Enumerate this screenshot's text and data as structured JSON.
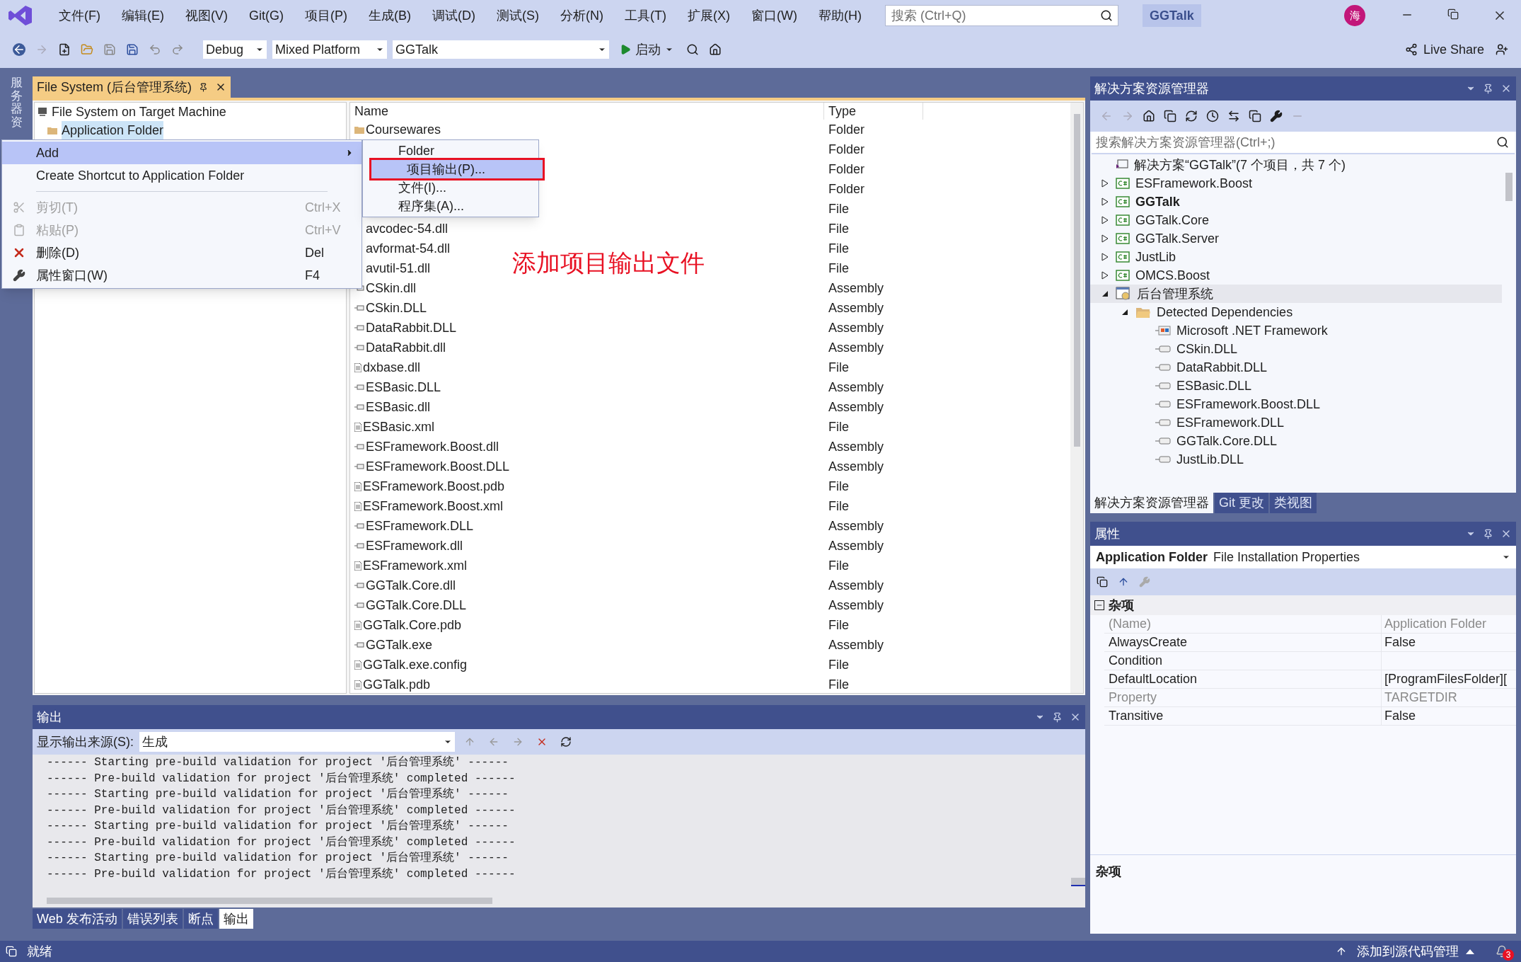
{
  "menu_bar": {
    "items": [
      "文件(F)",
      "编辑(E)",
      "视图(V)",
      "Git(G)",
      "项目(P)",
      "生成(B)",
      "调试(D)",
      "测试(S)",
      "分析(N)",
      "工具(T)",
      "扩展(X)",
      "窗口(W)",
      "帮助(H)"
    ],
    "search": {
      "placeholder": "搜索 (Ctrl+Q)"
    },
    "solution_name": "GGTalk",
    "avatar": "海"
  },
  "toolbar": {
    "configuration": "Debug",
    "platform": "Mixed Platform",
    "startup_project": "GGTalk",
    "start": "启动",
    "live_share": "Live Share"
  },
  "side_strip": {
    "label": "服务器资"
  },
  "document": {
    "tab": {
      "title": "File System (后台管理系统)",
      "selected": true
    },
    "tree": [
      {
        "label": "File System on Target Machine",
        "kind": "machine"
      },
      {
        "label": "Application Folder",
        "kind": "folder"
      }
    ],
    "columns": [
      "Name",
      "Type"
    ],
    "rows": [
      {
        "name": "Coursewares",
        "type": "Folder",
        "kind": "folder"
      },
      {
        "type": "Folder"
      },
      {
        "type": "Folder"
      },
      {
        "type": "Folder"
      },
      {
        "type": "File"
      },
      {
        "name": "avcodec-54.dll",
        "type": "File"
      },
      {
        "name": "avformat-54.dll",
        "type": "File"
      },
      {
        "name": "avutil-51.dll",
        "type": "File"
      },
      {
        "name": "CSkin.dll",
        "type": "Assembly",
        "kind": "assembly"
      },
      {
        "name": "CSkin.DLL",
        "type": "Assembly",
        "kind": "assembly"
      },
      {
        "name": "DataRabbit.DLL",
        "type": "Assembly",
        "kind": "assembly"
      },
      {
        "name": "DataRabbit.dll",
        "type": "Assembly",
        "kind": "assembly"
      },
      {
        "name": "dxbase.dll",
        "type": "File",
        "kind": "file"
      },
      {
        "name": "ESBasic.DLL",
        "type": "Assembly",
        "kind": "assembly"
      },
      {
        "name": "ESBasic.dll",
        "type": "Assembly",
        "kind": "assembly"
      },
      {
        "name": "ESBasic.xml",
        "type": "File",
        "kind": "file"
      },
      {
        "name": "ESFramework.Boost.dll",
        "type": "Assembly",
        "kind": "assembly"
      },
      {
        "name": "ESFramework.Boost.DLL",
        "type": "Assembly",
        "kind": "assembly"
      },
      {
        "name": "ESFramework.Boost.pdb",
        "type": "File",
        "kind": "file"
      },
      {
        "name": "ESFramework.Boost.xml",
        "type": "File",
        "kind": "file"
      },
      {
        "name": "ESFramework.DLL",
        "type": "Assembly",
        "kind": "assembly"
      },
      {
        "name": "ESFramework.dll",
        "type": "Assembly",
        "kind": "assembly"
      },
      {
        "name": "ESFramework.xml",
        "type": "File",
        "kind": "file"
      },
      {
        "name": "GGTalk.Core.dll",
        "type": "Assembly",
        "kind": "assembly"
      },
      {
        "name": "GGTalk.Core.DLL",
        "type": "Assembly",
        "kind": "assembly"
      },
      {
        "name": "GGTalk.Core.pdb",
        "type": "File",
        "kind": "file"
      },
      {
        "name": "GGTalk.exe",
        "type": "Assembly",
        "kind": "assembly"
      },
      {
        "name": "GGTalk.exe.config",
        "type": "File",
        "kind": "file"
      },
      {
        "name": "GGTalk.pdb",
        "type": "File",
        "kind": "file"
      }
    ],
    "annotation": "添加项目输出文件"
  },
  "context_menu": {
    "items": [
      {
        "label": "Add",
        "kind": "submenu",
        "selected": true,
        "disabled": false
      },
      {
        "label": "Create Shortcut to Application Folder",
        "kind": "item",
        "selected": false,
        "disabled": false
      },
      {
        "kind": "separator"
      },
      {
        "label": "剪切(T)",
        "shortcut": "Ctrl+X",
        "kind": "cut",
        "selected": false,
        "disabled": true
      },
      {
        "label": "粘贴(P)",
        "shortcut": "Ctrl+V",
        "kind": "paste",
        "selected": false,
        "disabled": true
      },
      {
        "label": "删除(D)",
        "shortcut": "Del",
        "kind": "delete",
        "selected": false,
        "disabled": false
      },
      {
        "label": "属性窗口(W)",
        "shortcut": "F4",
        "kind": "properties",
        "selected": false,
        "disabled": false
      }
    ],
    "submenu": [
      {
        "label": "Folder",
        "selected": false,
        "annotated": false
      },
      {
        "label": "项目输出(P)...",
        "selected": true,
        "annotated": true
      },
      {
        "label": "文件(I)...",
        "selected": false,
        "annotated": false
      },
      {
        "label": "程序集(A)...",
        "selected": false,
        "annotated": false
      }
    ]
  },
  "output": {
    "title": "输出",
    "source_label": "显示输出来源(S):",
    "source": "生成",
    "lines": [
      "------ Starting pre-build validation for project '后台管理系统' ------",
      "------ Pre-build validation for project '后台管理系统' completed ------",
      "------ Starting pre-build validation for project '后台管理系统' ------",
      "------ Pre-build validation for project '后台管理系统' completed ------",
      "------ Starting pre-build validation for project '后台管理系统' ------",
      "------ Pre-build validation for project '后台管理系统' completed ------",
      "------ Starting pre-build validation for project '后台管理系统' ------",
      "------ Pre-build validation for project '后台管理系统' completed ------"
    ],
    "tabs": [
      {
        "label": "Web 发布活动",
        "selected": false
      },
      {
        "label": "错误列表",
        "selected": false
      },
      {
        "label": "断点",
        "selected": false
      },
      {
        "label": "输出",
        "selected": true
      }
    ]
  },
  "solution_explorer": {
    "title": "解决方案资源管理器",
    "search": {
      "placeholder": "搜索解决方案资源管理器(Ctrl+;)"
    },
    "tree": [
      {
        "label": "解决方案“GGTalk”(7 个项目，共 7 个)",
        "kind": "solution",
        "selected": false,
        "startup": false,
        "children": [
          {
            "label": "ESFramework.Boost",
            "kind": "csharp",
            "expanded": false,
            "selected": false,
            "startup": false
          },
          {
            "label": "GGTalk",
            "kind": "csharp",
            "expanded": false,
            "selected": false,
            "startup": true
          },
          {
            "label": "GGTalk.Core",
            "kind": "csharp",
            "expanded": false,
            "selected": false,
            "startup": false
          },
          {
            "label": "GGTalk.Server",
            "kind": "csharp",
            "expanded": false,
            "selected": false,
            "startup": false
          },
          {
            "label": "JustLib",
            "kind": "csharp",
            "expanded": false,
            "selected": false,
            "startup": false
          },
          {
            "label": "OMCS.Boost",
            "kind": "csharp",
            "expanded": false,
            "selected": false,
            "startup": false
          },
          {
            "label": "后台管理系统",
            "kind": "setup",
            "expanded": true,
            "selected": true,
            "startup": false,
            "children": [
              {
                "label": "Detected Dependencies",
                "kind": "folder",
                "expanded": true,
                "selected": false,
                "startup": false,
                "children": [
                  {
                    "label": "Microsoft .NET Framework",
                    "kind": "framework",
                    "selected": false,
                    "startup": false
                  },
                  {
                    "label": "CSkin.DLL",
                    "kind": "reference",
                    "selected": false,
                    "startup": false
                  },
                  {
                    "label": "DataRabbit.DLL",
                    "kind": "reference",
                    "selected": false,
                    "startup": false
                  },
                  {
                    "label": "ESBasic.DLL",
                    "kind": "reference",
                    "selected": false,
                    "startup": false
                  },
                  {
                    "label": "ESFramework.Boost.DLL",
                    "kind": "reference",
                    "selected": false,
                    "startup": false
                  },
                  {
                    "label": "ESFramework.DLL",
                    "kind": "reference",
                    "selected": false,
                    "startup": false
                  },
                  {
                    "label": "GGTalk.Core.DLL",
                    "kind": "reference",
                    "selected": false,
                    "startup": false
                  },
                  {
                    "label": "JustLib.DLL",
                    "kind": "reference",
                    "selected": false,
                    "startup": false
                  }
                ]
              }
            ]
          }
        ]
      }
    ],
    "tabs": [
      {
        "label": "解决方案资源管理器",
        "selected": true
      },
      {
        "label": "Git 更改",
        "selected": false
      },
      {
        "label": "类视图",
        "selected": false
      }
    ]
  },
  "properties": {
    "title": "属性",
    "object": "Application Folder",
    "object_type": "File Installation Properties",
    "category": "杂项",
    "rows": [
      {
        "name": "(Name)",
        "value": "Application Folder",
        "readonly": true
      },
      {
        "name": "AlwaysCreate",
        "value": "False",
        "readonly": false
      },
      {
        "name": "Condition",
        "readonly": false
      },
      {
        "name": "DefaultLocation",
        "value": "[ProgramFilesFolder][",
        "readonly": false
      },
      {
        "name": "Property",
        "value": "TARGETDIR",
        "readonly": true
      },
      {
        "name": "Transitive",
        "value": "False",
        "readonly": false
      }
    ],
    "description_title": "杂项"
  },
  "status_bar": {
    "status": "就绪",
    "source_control": "添加到源代码管理",
    "notifications": "3"
  }
}
